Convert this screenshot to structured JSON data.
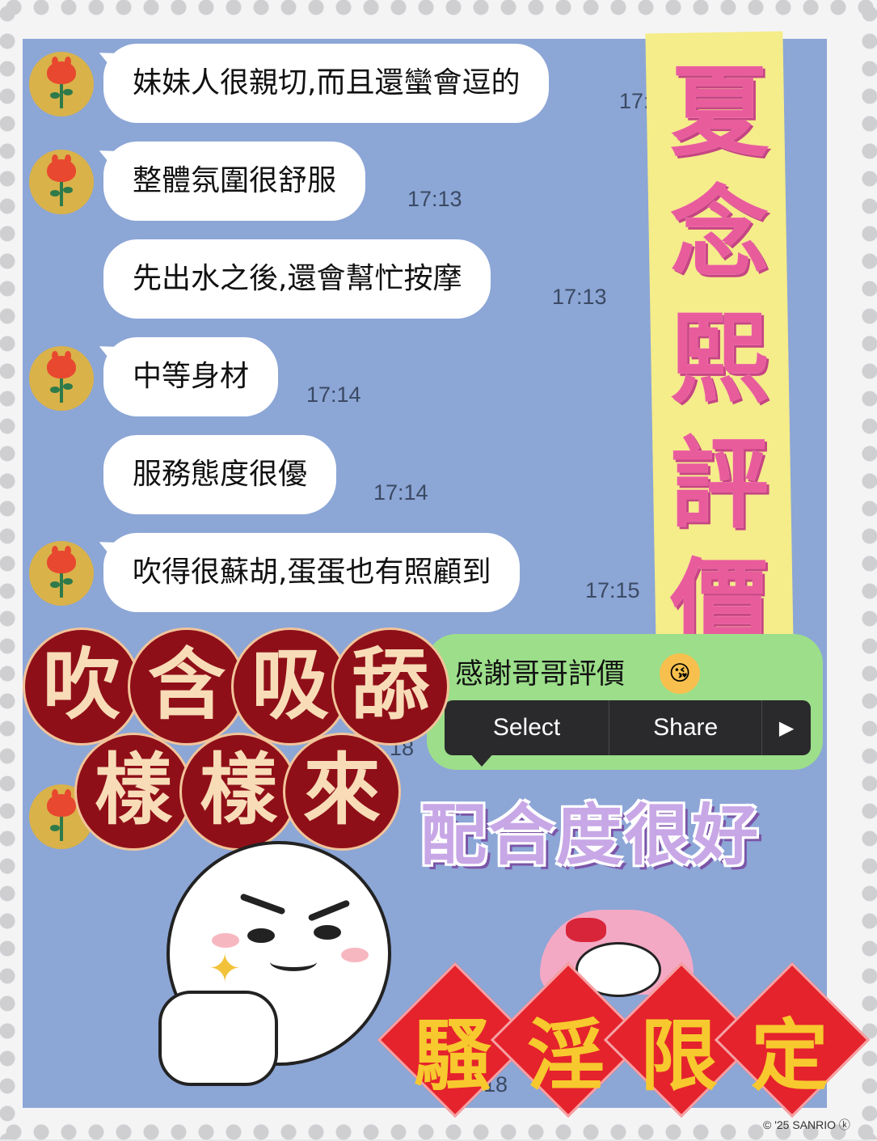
{
  "messages": [
    {
      "text": "妹妹人很親切,而且還蠻會逗的",
      "time": "17:",
      "avatar": true
    },
    {
      "text": "整體氛圍很舒服",
      "time": "17:13",
      "avatar": true
    },
    {
      "text": "先出水之後,還會幫忙按摩",
      "time": "17:13",
      "avatar": false
    },
    {
      "text": "中等身材",
      "time": "17:14",
      "avatar": true
    },
    {
      "text": "服務態度很優",
      "time": "17:14",
      "avatar": false
    },
    {
      "text": "吹得很蘇胡,蛋蛋也有照顧到",
      "time": "17:15",
      "avatar": true
    }
  ],
  "title_chars": [
    "夏",
    "念",
    "熙",
    "評",
    "價"
  ],
  "reply": {
    "text": "感謝哥哥評價",
    "emoji": "kiss-face-icon"
  },
  "context_menu": {
    "select": "Select",
    "share": "Share",
    "more": "▶"
  },
  "seal_row1": [
    "吹",
    "含",
    "吸",
    "舔"
  ],
  "seal_row2": [
    "樣",
    "樣",
    "來"
  ],
  "slogan": "配合度很好",
  "diamond_chars": [
    "騷",
    "淫",
    "限",
    "定"
  ],
  "partial_times": [
    "18",
    "18"
  ],
  "copyright": "© '25 SANRIO ⓚ",
  "colors": {
    "chat_bg": "#8ca6d6",
    "title_pink": "#e95c9c",
    "title_banner": "#f5ec8a",
    "reply_green": "#9cde8a",
    "seal_red": "#8f0f18",
    "diamond_red": "#e5232c",
    "diamond_gold": "#f7c92e",
    "slogan_purple": "#c8a7e6"
  }
}
